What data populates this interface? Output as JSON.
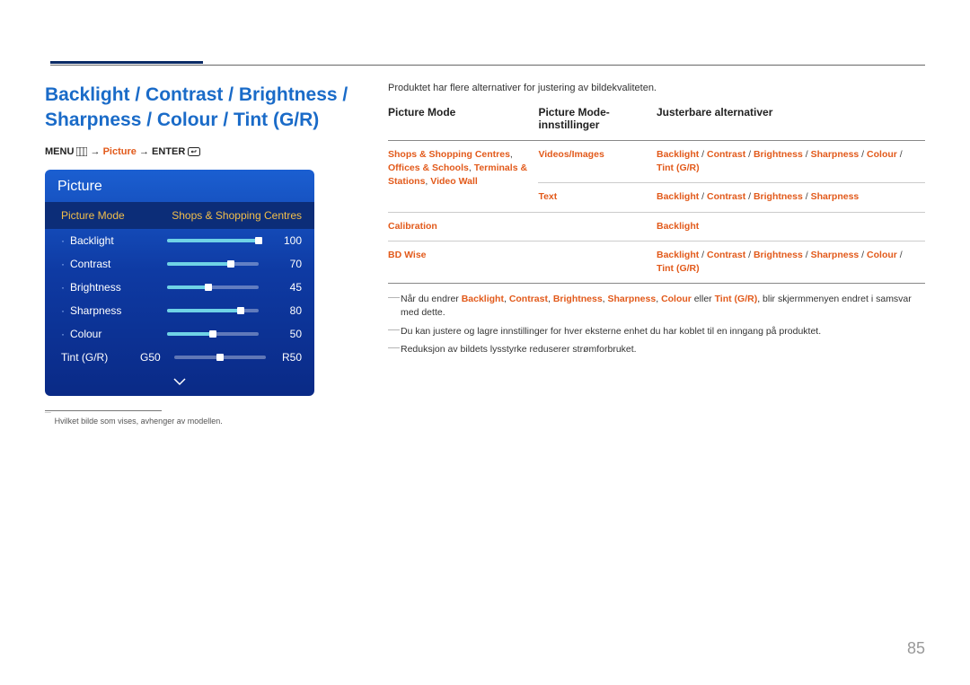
{
  "page_number": "85",
  "heading": "Backlight / Contrast / Brightness / Sharpness / Colour / Tint (G/R)",
  "breadcrumb": {
    "menu": "MENU",
    "picture": "Picture",
    "enter": "ENTER",
    "arrow": "→"
  },
  "osd": {
    "title": "Picture",
    "selected_label": "Picture Mode",
    "selected_value": "Shops & Shopping Centres",
    "rows": [
      {
        "label": "Backlight",
        "value": "100",
        "pct": 100
      },
      {
        "label": "Contrast",
        "value": "70",
        "pct": 70
      },
      {
        "label": "Brightness",
        "value": "45",
        "pct": 45
      },
      {
        "label": "Sharpness",
        "value": "80",
        "pct": 80
      },
      {
        "label": "Colour",
        "value": "50",
        "pct": 50
      }
    ],
    "tint": {
      "label": "Tint (G/R)",
      "g": "G50",
      "r": "R50"
    }
  },
  "left_footnote": "Hvilket bilde som vises, avhenger av modellen.",
  "intro": "Produktet har flere alternativer for justering av bildekvaliteten.",
  "table": {
    "headers": {
      "c1": "Picture Mode",
      "c2": "Picture Mode-innstillinger",
      "c3": "Justerbare alternativer"
    },
    "rows": [
      {
        "c1": [
          "Shops & Shopping Centres",
          ", ",
          "Offices & Schools",
          ", ",
          "Terminals & Stations",
          ", ",
          "Video Wall"
        ],
        "c2": [
          "Videos/Images"
        ],
        "c3": [
          "Backlight",
          " / ",
          "Contrast",
          " / ",
          "Brightness",
          " / ",
          "Sharpness",
          " / ",
          "Colour",
          " / ",
          "Tint (G/R)"
        ]
      },
      {
        "c1": [],
        "c2": [
          "Text"
        ],
        "c3": [
          "Backlight",
          " / ",
          "Contrast",
          " / ",
          "Brightness",
          " / ",
          "Sharpness"
        ]
      },
      {
        "c1": [
          "Calibration"
        ],
        "c2": [],
        "c3": [
          "Backlight"
        ]
      },
      {
        "c1": [
          "BD Wise"
        ],
        "c2": [],
        "c3": [
          "Backlight",
          " / ",
          "Contrast",
          " / ",
          "Brightness",
          " / ",
          "Sharpness",
          " / ",
          "Colour",
          " / ",
          "Tint (G/R)"
        ]
      }
    ]
  },
  "notes": [
    {
      "pre": "Når du endrer ",
      "terms": [
        "Backlight",
        ", ",
        "Contrast",
        ", ",
        "Brightness",
        ", ",
        "Sharpness",
        ", ",
        "Colour"
      ],
      "mid": " eller ",
      "term_last": "Tint (G/R)",
      "post": ", blir skjermmenyen endret i samsvar med dette."
    },
    {
      "plain": "Du kan justere og lagre innstillinger for hver eksterne enhet du har koblet til en inngang på produktet."
    },
    {
      "plain": "Reduksjon av bildets lysstyrke reduserer strømforbruket."
    }
  ]
}
